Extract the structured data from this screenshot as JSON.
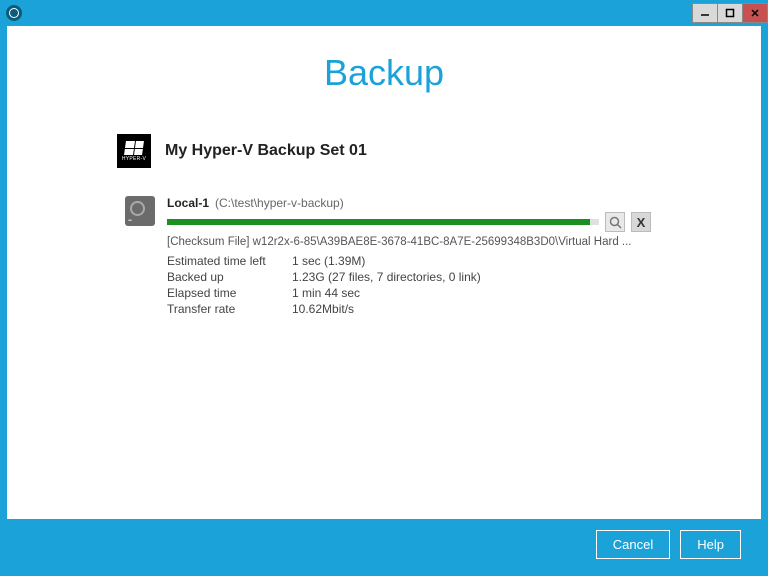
{
  "page": {
    "title": "Backup"
  },
  "set": {
    "logo_label": "HYPER-V",
    "name": "My Hyper-V Backup Set 01"
  },
  "dest": {
    "name": "Local-1",
    "path": "(C:\\test\\hyper-v-backup)",
    "file": "[Checksum File] w12r2x-6-85\\A39BAE8E-3678-41BC-8A7E-25699348B3D0\\Virtual Hard ...",
    "stats": {
      "eta_label": "Estimated time left",
      "eta_value": "1 sec (1.39M)",
      "backed_label": "Backed up",
      "backed_value": "1.23G (27 files, 7 directories, 0 link)",
      "elapsed_label": "Elapsed time",
      "elapsed_value": "1 min 44 sec",
      "rate_label": "Transfer rate",
      "rate_value": "10.62Mbit/s"
    }
  },
  "footer": {
    "cancel": "Cancel",
    "help": "Help"
  }
}
